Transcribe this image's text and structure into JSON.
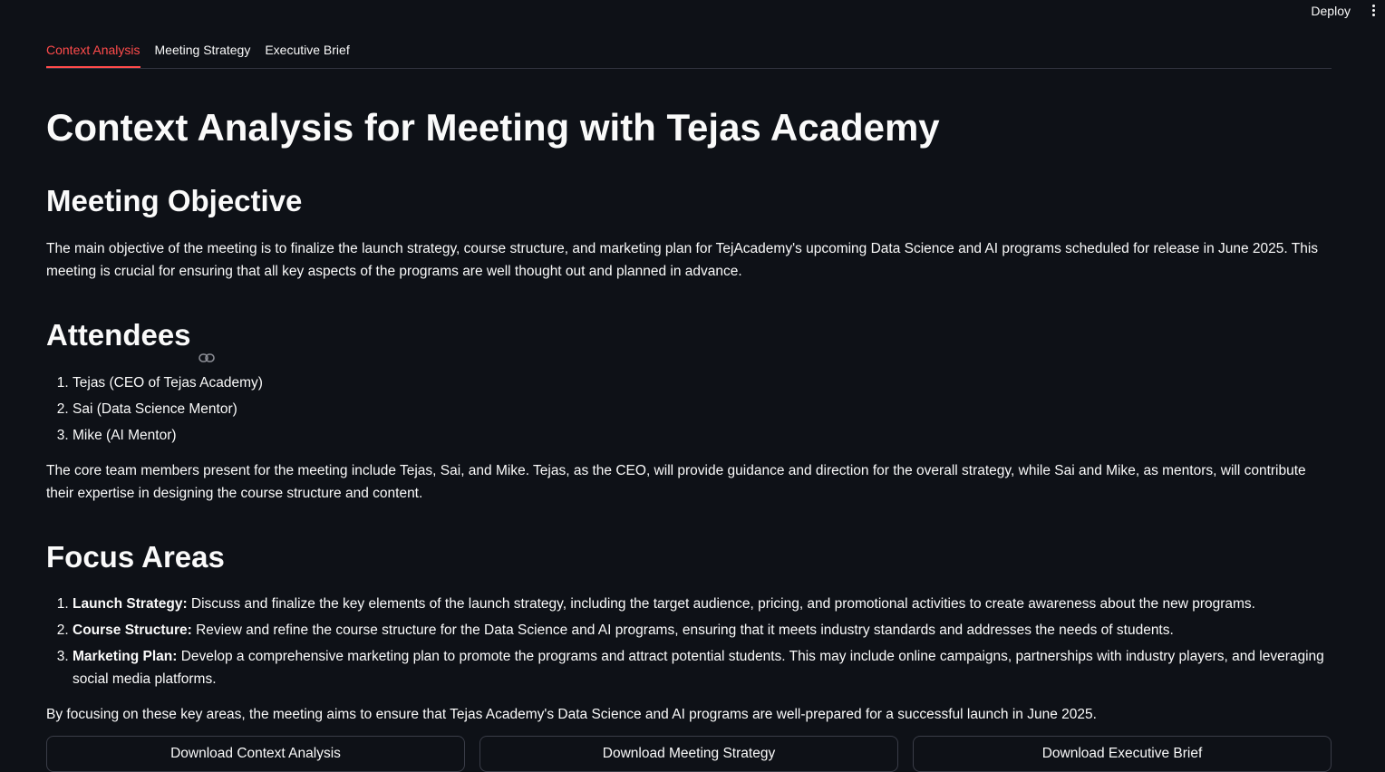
{
  "header": {
    "deploy_label": "Deploy",
    "menu_icon": "kebab-menu-icon"
  },
  "tabs": [
    {
      "label": "Context Analysis",
      "active": true
    },
    {
      "label": "Meeting Strategy",
      "active": false
    },
    {
      "label": "Executive Brief",
      "active": false
    }
  ],
  "accent_color": "#ff4b4b",
  "background_color": "#0e1117",
  "content": {
    "title": "Context Analysis for Meeting with Tejas Academy",
    "objective": {
      "heading": "Meeting Objective",
      "text": "The main objective of the meeting is to finalize the launch strategy, course structure, and marketing plan for TejAcademy's upcoming Data Science and AI programs scheduled for release in June 2025. This meeting is crucial for ensuring that all key aspects of the programs are well thought out and planned in advance."
    },
    "attendees": {
      "heading": "Attendees",
      "items": [
        "Tejas (CEO of Tejas Academy)",
        "Sai (Data Science Mentor)",
        "Mike (AI Mentor)"
      ],
      "summary": "The core team members present for the meeting include Tejas, Sai, and Mike. Tejas, as the CEO, will provide guidance and direction for the overall strategy, while Sai and Mike, as mentors, will contribute their expertise in designing the course structure and content."
    },
    "focus": {
      "heading": "Focus Areas",
      "items": [
        {
          "label": "Launch Strategy:",
          "text": " Discuss and finalize the key elements of the launch strategy, including the target audience, pricing, and promotional activities to create awareness about the new programs."
        },
        {
          "label": "Course Structure:",
          "text": " Review and refine the course structure for the Data Science and AI programs, ensuring that it meets industry standards and addresses the needs of students."
        },
        {
          "label": "Marketing Plan:",
          "text": " Develop a comprehensive marketing plan to promote the programs and attract potential students. This may include online campaigns, partnerships with industry players, and leveraging social media platforms."
        }
      ],
      "summary": "By focusing on these key areas, the meeting aims to ensure that Tejas Academy's Data Science and AI programs are well-prepared for a successful launch in June 2025."
    }
  },
  "downloads": [
    "Download Context Analysis",
    "Download Meeting Strategy",
    "Download Executive Brief"
  ]
}
